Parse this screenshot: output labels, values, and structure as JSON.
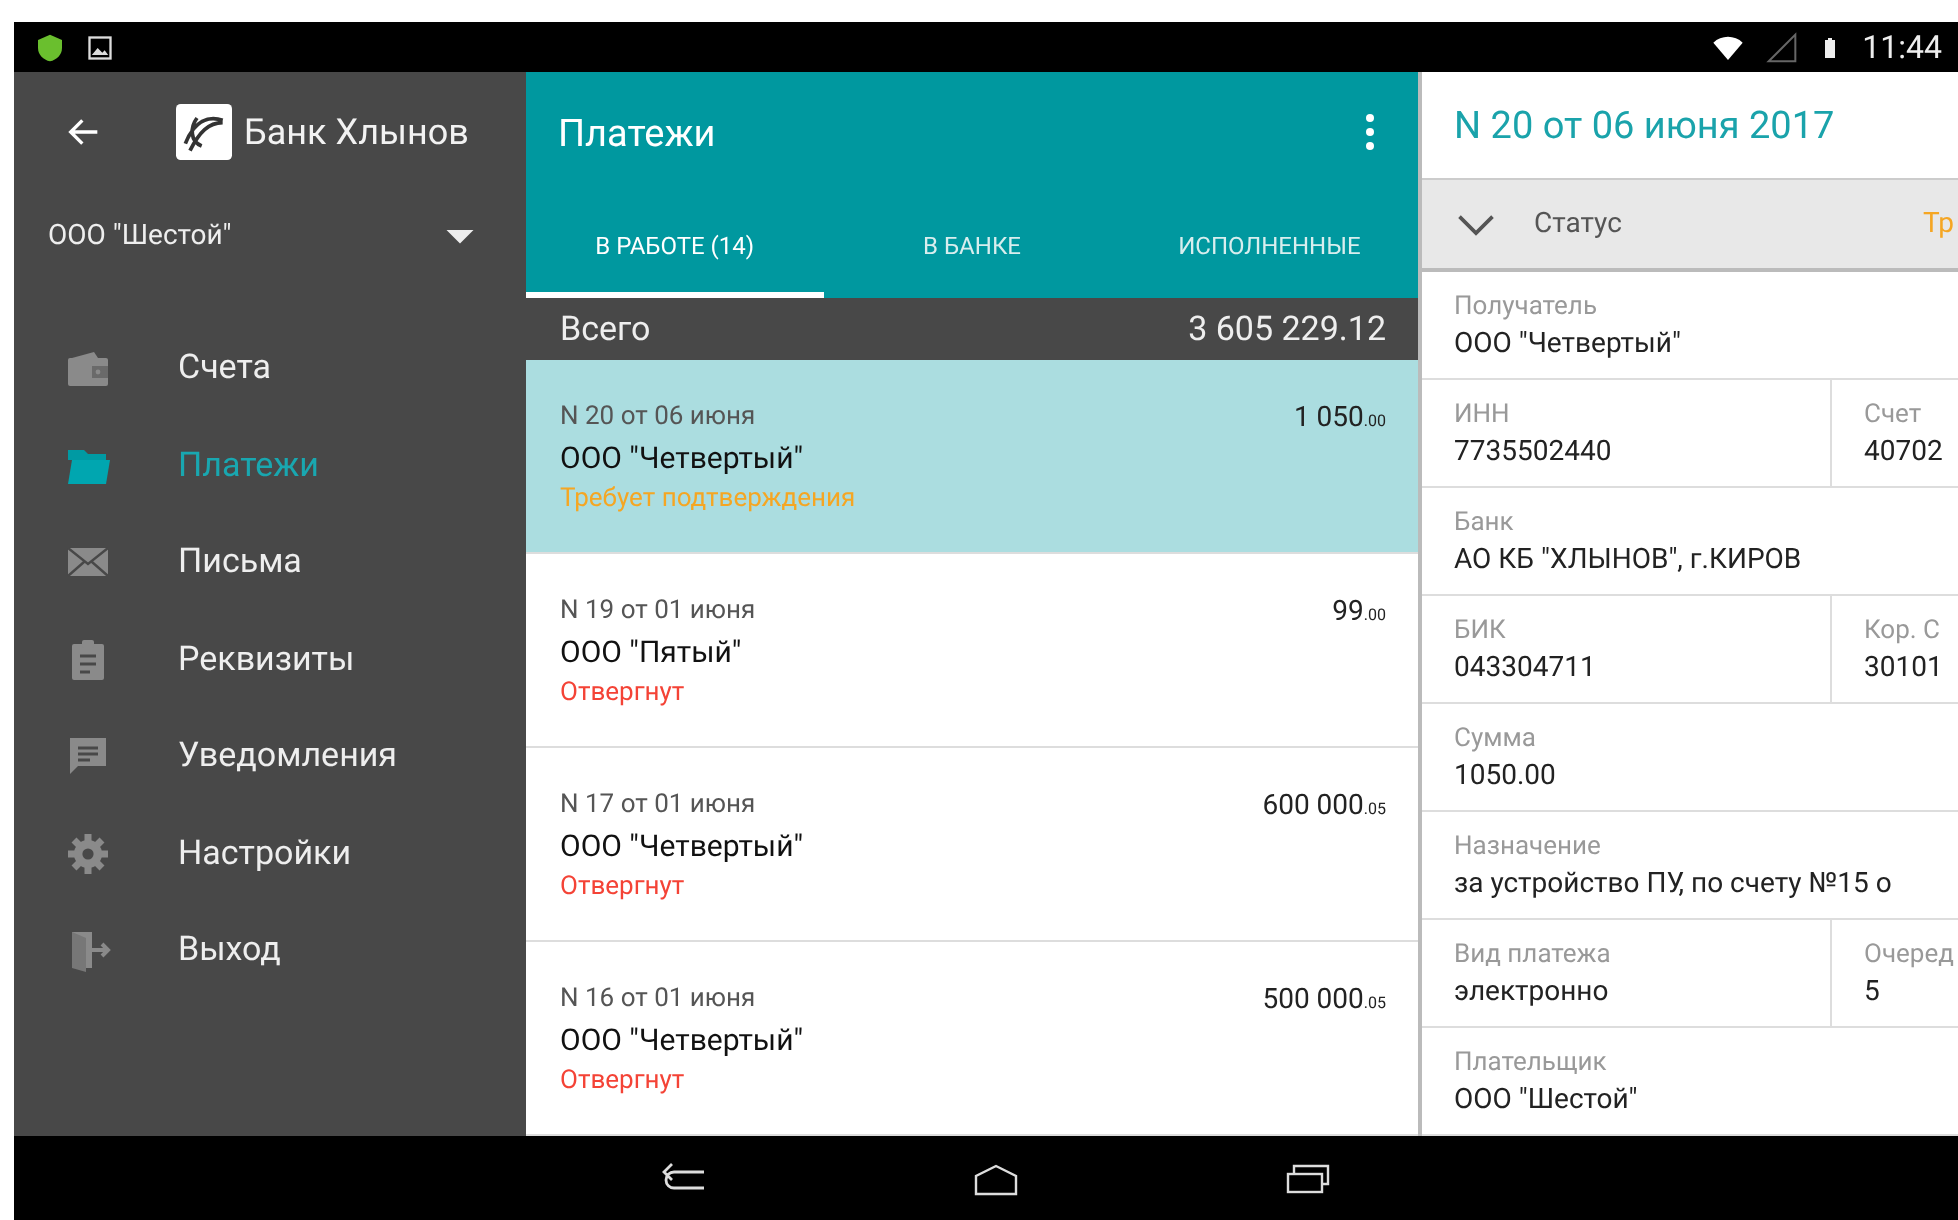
{
  "status_bar": {
    "time": "11:44"
  },
  "sidebar": {
    "title": "Банк Хлынов",
    "company": "ООО \"Шестой\"",
    "items": [
      {
        "label": "Счета",
        "kind": "wallet",
        "selected": false
      },
      {
        "label": "Платежи",
        "kind": "folder",
        "selected": true
      },
      {
        "label": "Письма",
        "kind": "mail",
        "selected": false
      },
      {
        "label": "Реквизиты",
        "kind": "clipboard",
        "selected": false
      },
      {
        "label": "Уведомления",
        "kind": "chat",
        "selected": false
      },
      {
        "label": "Настройки",
        "kind": "gear",
        "selected": false
      },
      {
        "label": "Выход",
        "kind": "exit",
        "selected": false
      }
    ]
  },
  "payments": {
    "title": "Платежи",
    "tabs": [
      {
        "label": "В РАБОТЕ (14)",
        "selected": true
      },
      {
        "label": "В БАНКЕ",
        "selected": false
      },
      {
        "label": "ИСПОЛНЕННЫЕ",
        "selected": false
      }
    ],
    "total": {
      "label": "Всего",
      "value": "3 605 229.12"
    },
    "items": [
      {
        "number": "N 20 от 06 июня",
        "name": "ООО \"Четвертый\"",
        "status": "Требует подтверждения",
        "color": "#f5a623",
        "amount": "1 050",
        "cents": ".00",
        "selected": true
      },
      {
        "number": "N 19 от 01 июня",
        "name": "ООО \"Пятый\"",
        "status": "Отвергнут",
        "color": "#f44336",
        "amount": "99",
        "cents": ".00",
        "selected": false
      },
      {
        "number": "N 17 от 01 июня",
        "name": "ООО \"Четвертый\"",
        "status": "Отвергнут",
        "color": "#f44336",
        "amount": "600 000",
        "cents": ".05",
        "selected": false
      },
      {
        "number": "N 16 от 01 июня",
        "name": "ООО \"Четвертый\"",
        "status": "Отвергнут",
        "color": "#f44336",
        "amount": "500 000",
        "cents": ".05",
        "selected": false
      }
    ]
  },
  "detail": {
    "title": "N 20 от 06 июня 2017",
    "status": {
      "label": "Статус",
      "value": "Тр",
      "expanded": false
    },
    "rows": [
      [
        {
          "label": "Получатель",
          "value": "ООО \"Четвертый\""
        }
      ],
      [
        {
          "label": "ИНН",
          "value": "7735502440"
        },
        {
          "label": "Счет",
          "value": "40702"
        }
      ],
      [
        {
          "label": "Банк",
          "value": "АО КБ \"ХЛЫНОВ\", г.КИРОВ"
        }
      ],
      [
        {
          "label": "БИК",
          "value": "043304711"
        },
        {
          "label": "Кор. С",
          "value": "30101"
        }
      ],
      [
        {
          "label": "Сумма",
          "value": "1050.00"
        }
      ],
      [
        {
          "label": "Назначение",
          "value": "за устройство ПУ, по счету №15 о"
        }
      ],
      [
        {
          "label": "Вид платежа",
          "value": "электронно"
        },
        {
          "label": "Очеред",
          "value": "5"
        }
      ],
      [
        {
          "label": "Плательщик",
          "value": "ООО \"Шестой\""
        }
      ]
    ]
  }
}
